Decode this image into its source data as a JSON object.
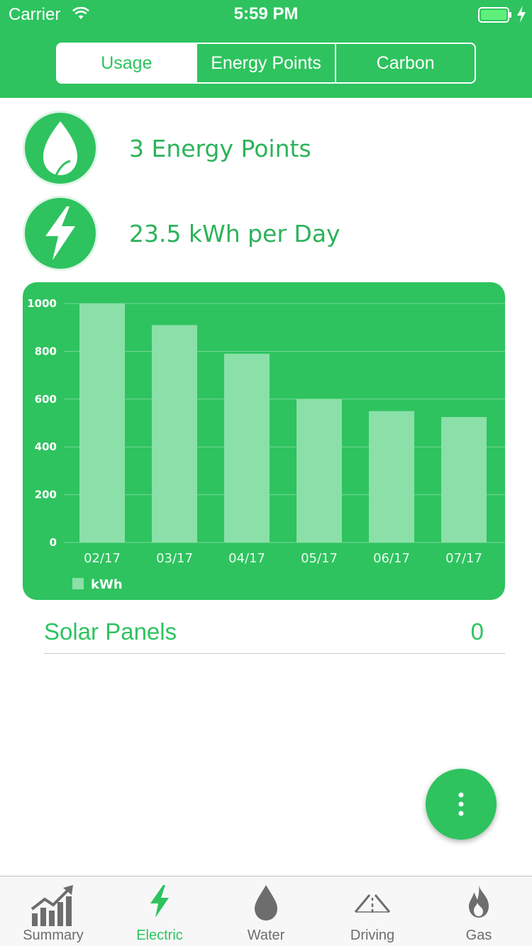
{
  "status_bar": {
    "carrier": "Carrier",
    "time": "5:59 PM"
  },
  "segments": [
    {
      "label": "Usage",
      "active": true
    },
    {
      "label": "Energy Points",
      "active": false
    },
    {
      "label": "Carbon",
      "active": false
    }
  ],
  "summary": {
    "points_text": "3 Energy Points",
    "usage_text": "23.5 kWh per Day"
  },
  "chart_data": {
    "type": "bar",
    "categories": [
      "02/17",
      "03/17",
      "04/17",
      "05/17",
      "06/17",
      "07/17"
    ],
    "series": [
      {
        "name": "kWh",
        "values": [
          1000,
          910,
          790,
          600,
          550,
          525
        ]
      }
    ],
    "ylim": [
      0,
      1000
    ],
    "yticks": [
      "0",
      "200",
      "400",
      "600",
      "800",
      "1000"
    ],
    "grid": true,
    "legend": "bottom-left"
  },
  "solar": {
    "label": "Solar Panels",
    "value": "0"
  },
  "tabs": [
    {
      "label": "Summary",
      "icon": "chart-icon",
      "active": false
    },
    {
      "label": "Electric",
      "icon": "bolt-icon",
      "active": true
    },
    {
      "label": "Water",
      "icon": "drop-icon",
      "active": false
    },
    {
      "label": "Driving",
      "icon": "road-icon",
      "active": false
    },
    {
      "label": "Gas",
      "icon": "flame-icon",
      "active": false
    }
  ],
  "colors": {
    "accent": "#2ec35f",
    "bar": "#8ae0a8",
    "inactive": "#6d6d6d"
  }
}
